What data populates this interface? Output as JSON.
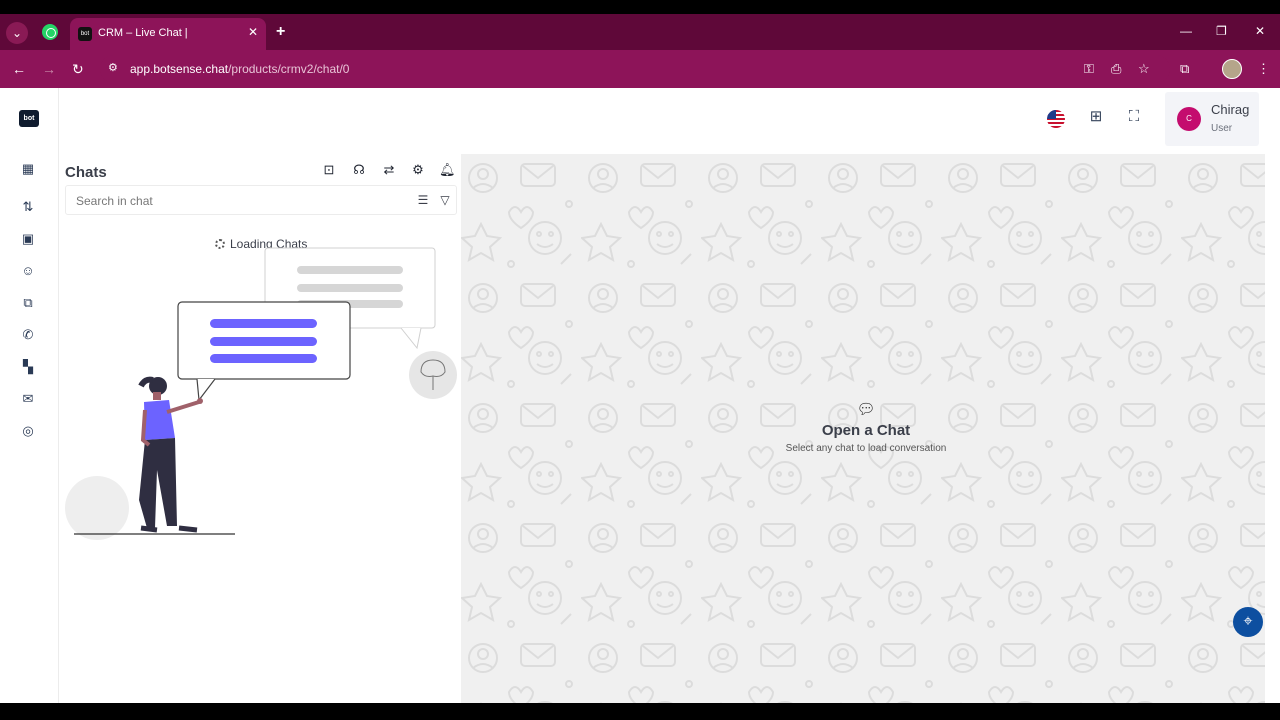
{
  "browser": {
    "tab_title": "CRM – Live Chat |",
    "tab_favicon": "bot",
    "url_domain": "app.botsense.chat",
    "url_path": "/products/crmv2/chat/0",
    "accent": "#8d1459"
  },
  "sidebar": {
    "logo_text": "bot",
    "icons": [
      "dashboard-icon",
      "flows-icon",
      "briefcase-icon",
      "bot-icon",
      "integrations-icon",
      "phone-icon",
      "apps-icon",
      "chat-bubble-icon",
      "support-icon"
    ]
  },
  "topbar": {
    "user_name": "Chirag",
    "user_role": "User",
    "avatar_initial": "C"
  },
  "chats": {
    "title": "Chats",
    "search_placeholder": "Search in chat",
    "loading_text": "Loading Chats"
  },
  "main": {
    "empty_title": "Open a Chat",
    "empty_subtitle": "Select any chat to load conversation"
  }
}
